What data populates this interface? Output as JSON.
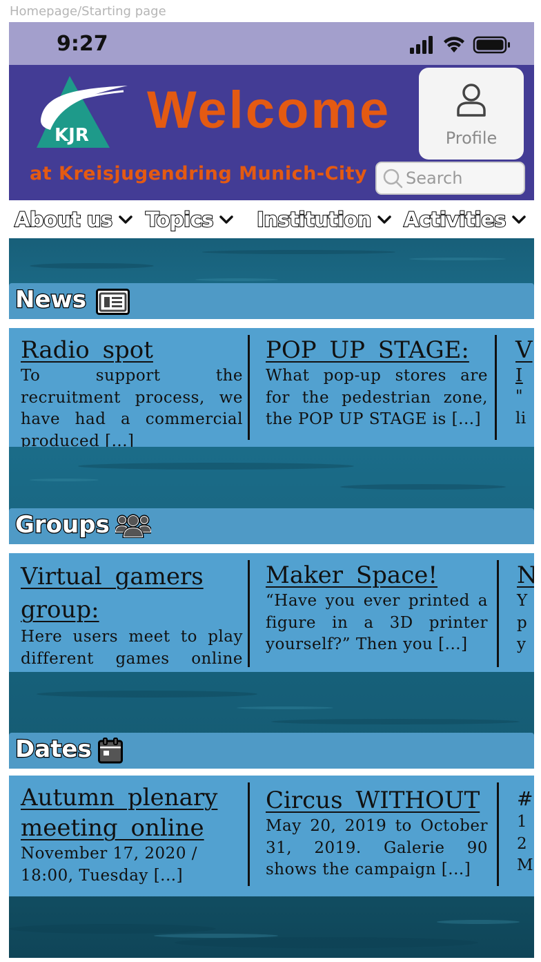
{
  "frame_label": "Homepage/Starting page",
  "status_bar": {
    "time": "9:27"
  },
  "header": {
    "logo_text": "KJR",
    "welcome": "Welcome",
    "subtitle": "at Kreisjugendring Munich-City",
    "profile_label": "Profile",
    "search_placeholder": "Search"
  },
  "nav": [
    {
      "label": "About us"
    },
    {
      "label": "Topics"
    },
    {
      "label": "Institution"
    },
    {
      "label": "Activities"
    }
  ],
  "sections": {
    "news": {
      "title": "News",
      "icon": "newspaper-icon",
      "cards": [
        {
          "title": "Radio spot",
          "body": "To support the recruitment process, we have had a commercial produced [...]"
        },
        {
          "title": "POP UP STAGE:",
          "body": "What pop-up stores are for the pedestrian zone, the POP UP STAGE is [...]"
        },
        {
          "title": "V",
          "title2": "I",
          "body_lines": [
            "\"",
            "li"
          ]
        }
      ]
    },
    "groups": {
      "title": "Groups",
      "icon": "users-icon",
      "cards": [
        {
          "title": "Virtual gamers group:",
          "body": "Here users meet to play different games online [...]"
        },
        {
          "title": "Maker Space!",
          "body": "“Have you ever printed a figure in a 3D printer yourself?” Then you [...]"
        },
        {
          "title": "N",
          "body_lines": [
            "Y",
            "p",
            "y"
          ]
        }
      ]
    },
    "dates": {
      "title": "Dates",
      "icon": "calendar-icon",
      "cards": [
        {
          "title": "Autumn plenary meeting online",
          "body": "November 17, 2020 / 18:00, Tuesday [...]"
        },
        {
          "title": "Circus WITHOUT",
          "body": "May 20, 2019 to October 31, 2019. Galerie 90 shows the campaign [...]"
        },
        {
          "title": "#",
          "body_lines": [
            "1",
            "2",
            "M"
          ]
        }
      ]
    }
  },
  "colors": {
    "status_bar": "#a39fcc",
    "header_bg": "#433c95",
    "accent_orange": "#e45a12",
    "card_blue": "#52a1d0",
    "section_bar": "#4f9ac6",
    "logo_teal": "#1e9a8a"
  }
}
